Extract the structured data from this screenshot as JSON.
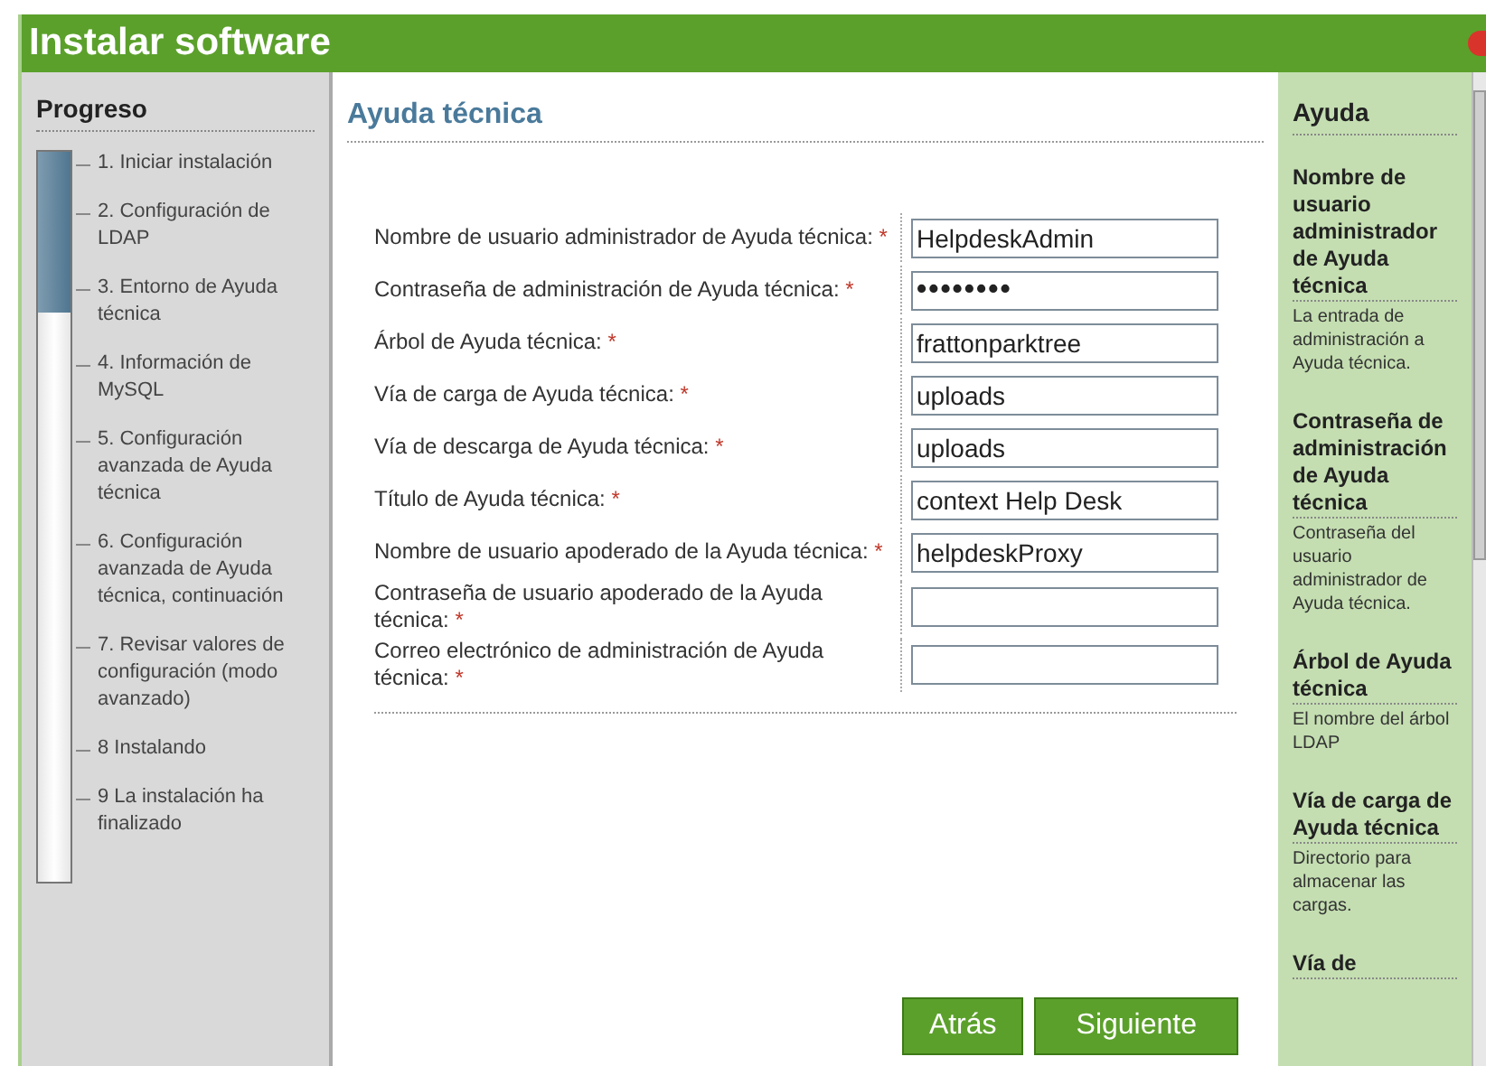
{
  "window": {
    "title": "Instalar software"
  },
  "progress": {
    "title": "Progreso",
    "level": 0.22,
    "steps": [
      {
        "label": "1. Iniciar instalación"
      },
      {
        "label": "2. Configuración de LDAP"
      },
      {
        "label": "3. Entorno de Ayuda técnica"
      },
      {
        "label": "4. Información de MySQL"
      },
      {
        "label": "5. Configuración avanzada de Ayuda técnica"
      },
      {
        "label": "6. Configuración avanzada de Ayuda técnica, continuación"
      },
      {
        "label": "7. Revisar valores de configuración (modo avanzado)"
      },
      {
        "label": "8 Instalando"
      },
      {
        "label": "9 La instalación ha finalizado"
      }
    ]
  },
  "main": {
    "title": "Ayuda técnica",
    "fields": [
      {
        "label": "Nombre de usuario administrador de Ayuda técnica:",
        "required_mark": "*",
        "value": "HelpdeskAdmin",
        "kind": "text"
      },
      {
        "label": "Contraseña de administración de Ayuda técnica:",
        "required_mark": "*",
        "value": "••••••••",
        "kind": "password"
      },
      {
        "label": "Árbol de Ayuda técnica:",
        "required_mark": "*",
        "value": "frattonparktree",
        "kind": "text"
      },
      {
        "label": "Vía de carga de Ayuda técnica:",
        "required_mark": "*",
        "value": "uploads",
        "kind": "text"
      },
      {
        "label": "Vía de descarga de Ayuda técnica:",
        "required_mark": "*",
        "value": "uploads",
        "kind": "text"
      },
      {
        "label": "Título de Ayuda técnica:",
        "required_mark": "*",
        "value": "context Help Desk",
        "kind": "text"
      },
      {
        "label": "Nombre de usuario apoderado de la Ayuda técnica:",
        "required_mark": "*",
        "value": "helpdeskProxy",
        "kind": "text"
      },
      {
        "label": "Contraseña de usuario apoderado de la Ayuda técnica:",
        "required_mark": "*",
        "kind": "password"
      },
      {
        "label": "Correo electrónico de administración de Ayuda técnica:",
        "required_mark": "*",
        "kind": "text"
      }
    ],
    "buttons": [
      "Atrás",
      "Siguiente"
    ]
  },
  "help": {
    "title": "Ayuda",
    "sections": [
      {
        "title": "Nombre de usuario administrador de Ayuda técnica",
        "text": "La entrada de administración a Ayuda técnica."
      },
      {
        "title": "Contraseña de administración de Ayuda técnica",
        "text": "Contraseña del usuario administrador de Ayuda técnica."
      },
      {
        "title": "Árbol de Ayuda técnica",
        "text": "El nombre del árbol LDAP"
      },
      {
        "title": "Vía de carga de Ayuda técnica",
        "text": "Directorio para almacenar las cargas."
      },
      {
        "title": "Vía de"
      }
    ]
  }
}
